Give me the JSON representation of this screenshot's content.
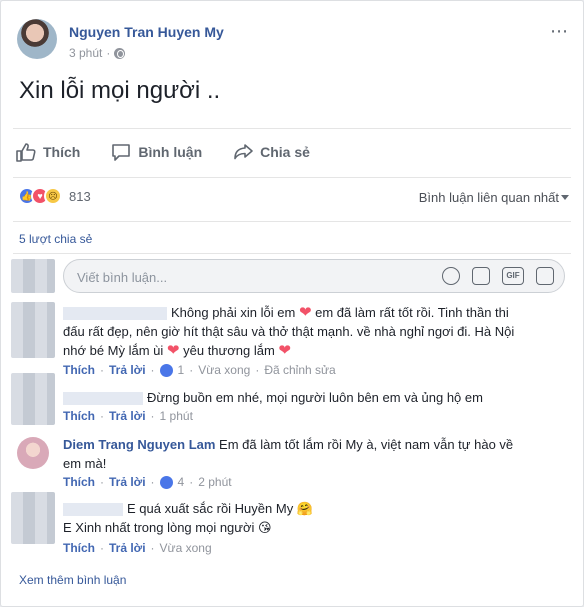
{
  "post": {
    "author": "Nguyen Tran Huyen My",
    "time": "3 phút",
    "text": "Xin lỗi mọi người ..",
    "more_icon": "⋯"
  },
  "actions": {
    "like": "Thích",
    "comment": "Bình luận",
    "share": "Chia sẻ"
  },
  "reactions": {
    "count": "813",
    "types": [
      "like-icon",
      "love-icon",
      "sad-icon"
    ],
    "sort_label": "Bình luận liên quan nhất"
  },
  "shares_text": "5 lượt chia sẻ",
  "comment_input": {
    "placeholder": "Viết bình luận..."
  },
  "comments": [
    {
      "name": "",
      "text_1": "Không phải xin lỗi em",
      "text_2": "em đã làm rất tốt rồi. Tinh thần thi",
      "line_2": "đấu rất đẹp, nên giờ hít thật sâu và thở thật mạnh. về nhà nghỉ ngơi đi. Hà Nội",
      "line_3a": "nhớ bé Mỳ lắm ùi",
      "line_3b": "yêu thương lắm",
      "like": "Thích",
      "reply": "Trả lời",
      "likes": "1",
      "time": "Vừa xong",
      "edited": "Đã chỉnh sửa"
    },
    {
      "name": "",
      "text": "Đừng buồn em nhé, mọi người luôn bên em và ủng hộ em",
      "like": "Thích",
      "reply": "Trả lời",
      "time": "1 phút"
    },
    {
      "name": "Diem Trang Nguyen Lam",
      "text_1": "Em đã làm tốt lắm rồi My à, việt nam vẫn tự hào về",
      "text_2": "em mà!",
      "like": "Thích",
      "reply": "Trả lời",
      "likes": "4",
      "time": "2 phút"
    },
    {
      "name": "",
      "text_1": "E quá xuất sắc rồi Huyền My",
      "text_2": "E Xinh nhất trong lòng mọi người",
      "like": "Thích",
      "reply": "Trả lời",
      "time": "Vừa xong"
    }
  ],
  "more_comments": "Xem thêm bình luận",
  "colors": {
    "link": "#365899",
    "accent": "#4267b2",
    "heart": "#f25268"
  }
}
